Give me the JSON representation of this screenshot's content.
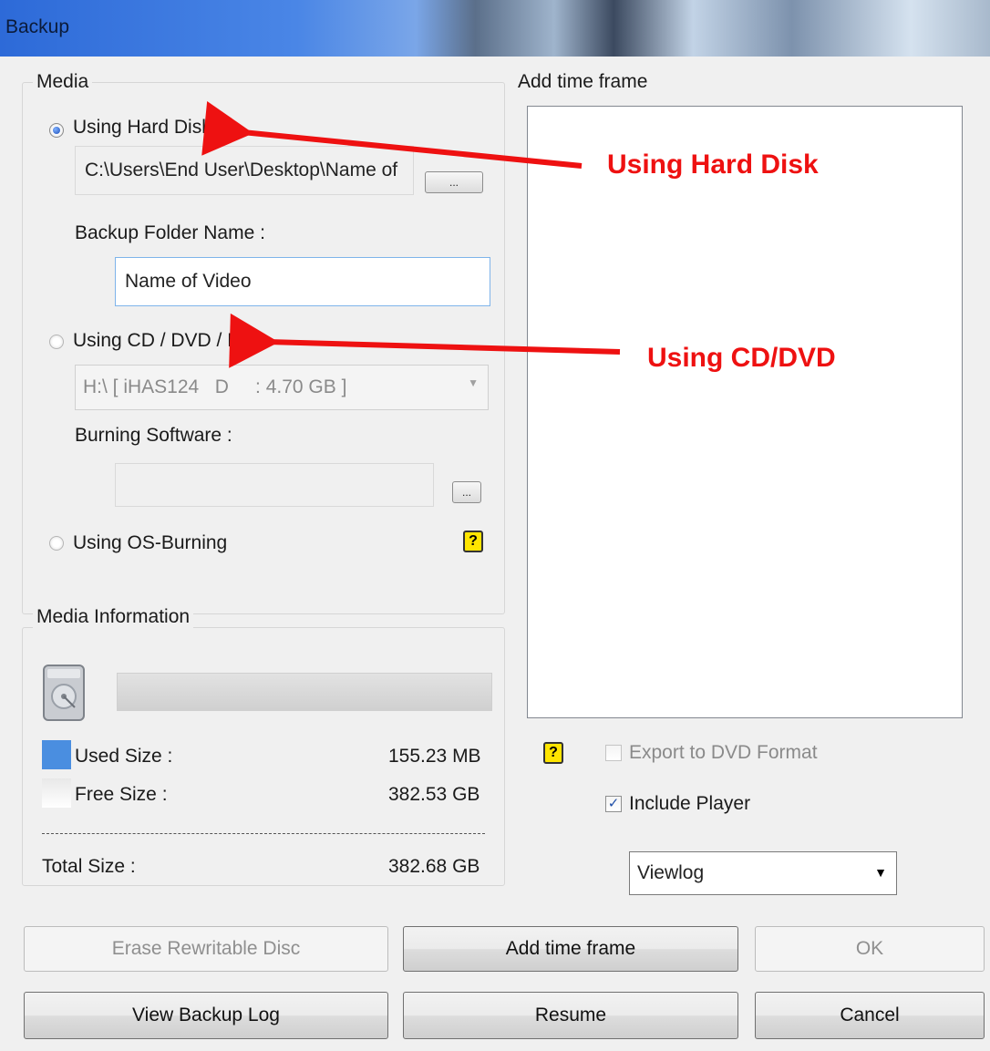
{
  "window": {
    "title": "Backup"
  },
  "media": {
    "group_title": "Media",
    "hard_disk": {
      "label": "Using Hard Disk",
      "selected": true,
      "path": "C:\\Users\\End User\\Desktop\\Name of",
      "browse_label": "..."
    },
    "folder": {
      "label": "Backup Folder Name :",
      "value": "Name of Video"
    },
    "cd_dvd": {
      "label": "Using CD / DVD / BD",
      "selected": false,
      "drive": "H:\\ [ iHAS124   D     : 4.70 GB ]"
    },
    "burning": {
      "label": "Burning Software :",
      "value": "",
      "browse_label": "..."
    },
    "os_burning": {
      "label": "Using OS-Burning",
      "selected": false
    },
    "help_glyph": "?"
  },
  "media_info": {
    "group_title": "Media Information",
    "used_label": "Used Size :",
    "used_value": "155.23 MB",
    "free_label": "Free Size :",
    "free_value": "382.53 GB",
    "total_label": "Total Size :",
    "total_value": "382.68 GB",
    "used_color": "#4a8ee0"
  },
  "time_frame": {
    "group_title": "Add time frame",
    "export_dvd": {
      "label": "Export to DVD Format",
      "checked": false,
      "enabled": false
    },
    "include_player": {
      "label": "Include Player",
      "checked": true
    },
    "player_select": "Viewlog",
    "help_glyph": "?"
  },
  "buttons": {
    "erase": "Erase Rewritable Disc",
    "add_time_frame": "Add time frame",
    "ok": "OK",
    "view_log": "View Backup Log",
    "resume": "Resume",
    "cancel": "Cancel"
  },
  "annotations": {
    "hard_disk": "Using Hard Disk",
    "cd_dvd": "Using CD/DVD",
    "color": "#ee1111"
  }
}
